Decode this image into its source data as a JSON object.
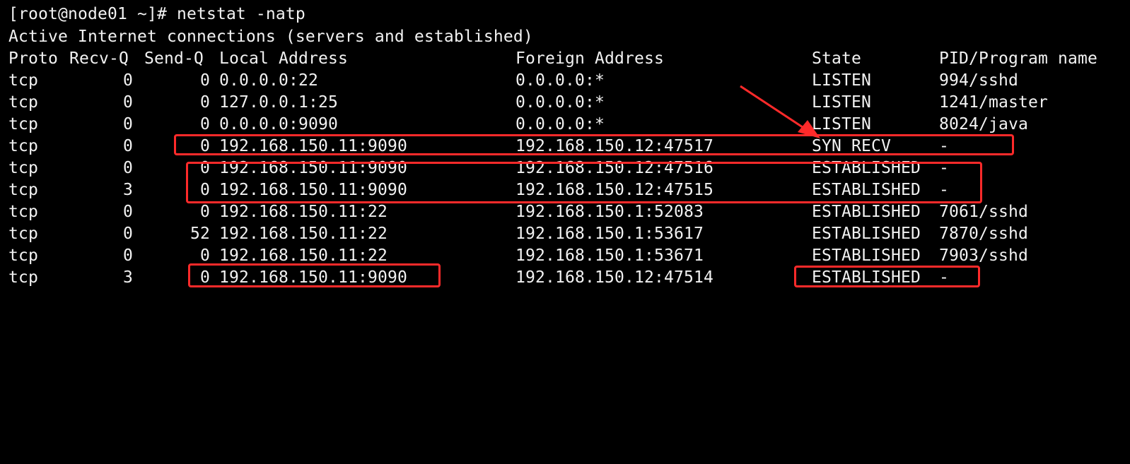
{
  "terminal": {
    "prompt": "[root@node01 ~]# netstat -natp",
    "summary": "Active Internet connections (servers and established)",
    "headers": {
      "proto": "Proto",
      "recvq": "Recv-Q",
      "sendq": "Send-Q",
      "local": "Local Address",
      "foreign": "Foreign Address",
      "state": "State",
      "pid": "PID/Program name"
    },
    "rows": [
      {
        "proto": "tcp",
        "recvq": "0",
        "sendq": "0",
        "local": "0.0.0.0:22",
        "foreign": "0.0.0.0:*",
        "state": "LISTEN",
        "pid": "994/sshd"
      },
      {
        "proto": "tcp",
        "recvq": "0",
        "sendq": "0",
        "local": "127.0.0.1:25",
        "foreign": "0.0.0.0:*",
        "state": "LISTEN",
        "pid": "1241/master"
      },
      {
        "proto": "tcp",
        "recvq": "0",
        "sendq": "0",
        "local": "0.0.0.0:9090",
        "foreign": "0.0.0.0:*",
        "state": "LISTEN",
        "pid": "8024/java"
      },
      {
        "proto": "tcp",
        "recvq": "0",
        "sendq": "0",
        "local": "192.168.150.11:9090",
        "foreign": "192.168.150.12:47517",
        "state": "SYN_RECV",
        "pid": "-"
      },
      {
        "proto": "tcp",
        "recvq": "0",
        "sendq": "0",
        "local": "192.168.150.11:9090",
        "foreign": "192.168.150.12:47516",
        "state": "ESTABLISHED",
        "pid": "-"
      },
      {
        "proto": "tcp",
        "recvq": "3",
        "sendq": "0",
        "local": "192.168.150.11:9090",
        "foreign": "192.168.150.12:47515",
        "state": "ESTABLISHED",
        "pid": "-"
      },
      {
        "proto": "tcp",
        "recvq": "0",
        "sendq": "0",
        "local": "192.168.150.11:22",
        "foreign": "192.168.150.1:52083",
        "state": "ESTABLISHED",
        "pid": "7061/sshd"
      },
      {
        "proto": "tcp",
        "recvq": "0",
        "sendq": "52",
        "local": "192.168.150.11:22",
        "foreign": "192.168.150.1:53617",
        "state": "ESTABLISHED",
        "pid": "7870/sshd"
      },
      {
        "proto": "tcp",
        "recvq": "0",
        "sendq": "0",
        "local": "192.168.150.11:22",
        "foreign": "192.168.150.1:53671",
        "state": "ESTABLISHED",
        "pid": "7903/sshd"
      },
      {
        "proto": "tcp",
        "recvq": "3",
        "sendq": "0",
        "local": "192.168.150.11:9090",
        "foreign": "192.168.150.12:47514",
        "state": "ESTABLISHED",
        "pid": "-"
      }
    ]
  },
  "colors": {
    "background": "#000000",
    "text": "#f2f2f2",
    "annotation": "#ff2a2a"
  }
}
